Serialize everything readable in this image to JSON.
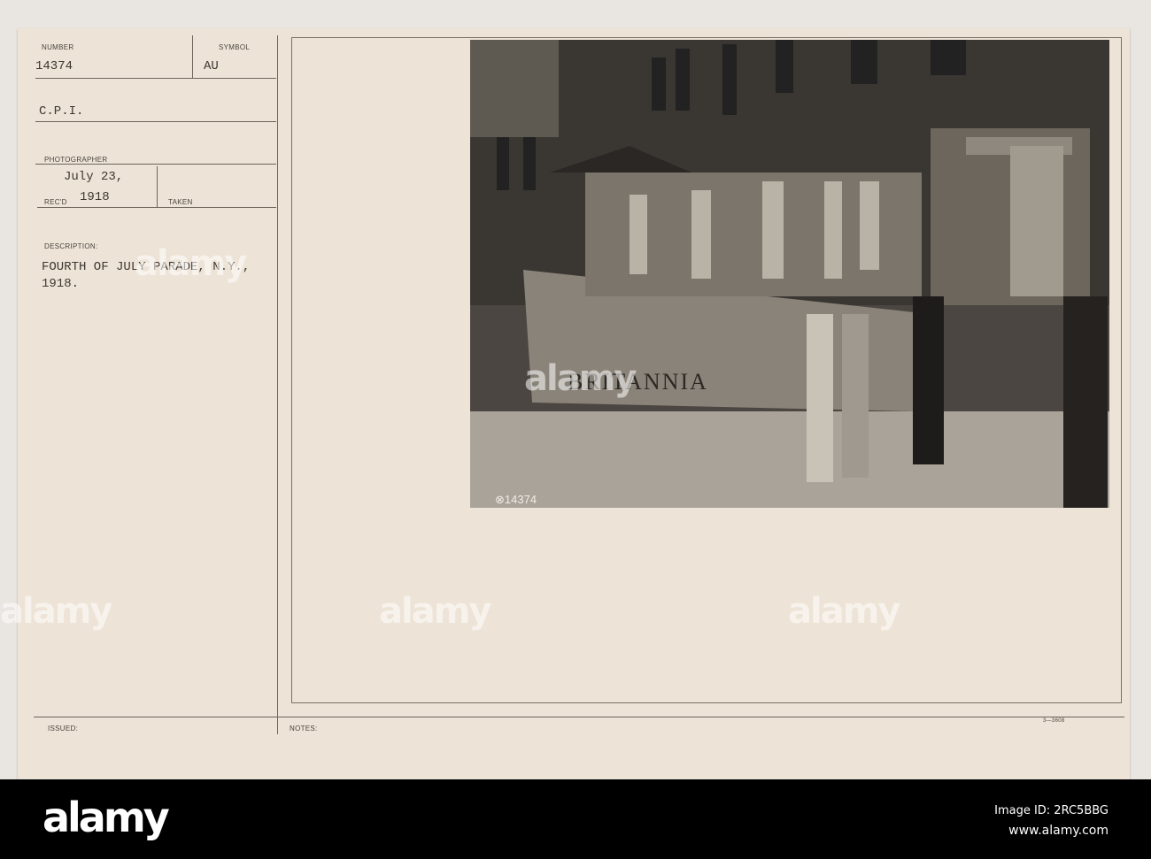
{
  "card": {
    "number_label": "NUMBER",
    "number_value": "14374",
    "symbol_label": "SYMBOL",
    "symbol_value": "AU",
    "agency": "C.P.I.",
    "photographer_label": "PHOTOGRAPHER",
    "recd_date_line1": "July 23,",
    "recd_date_line2": "1918",
    "recd_label": "REC'D",
    "taken_label": "TAKEN",
    "description_label": "DESCRIPTION:",
    "description_line1": "FOURTH OF JULY PARADE, N.Y.,",
    "description_line2": "1918.",
    "issued_label": "ISSUED:",
    "notes_label": "NOTES:",
    "form_code": "3—3608"
  },
  "photo": {
    "float_sign": "BRITANNIA",
    "negative_number": "⊗14374"
  },
  "watermark": "alamy",
  "footer": {
    "logo": "alamy",
    "image_id": "Image ID: 2RC5BBG",
    "website": "www.alamy.com"
  }
}
